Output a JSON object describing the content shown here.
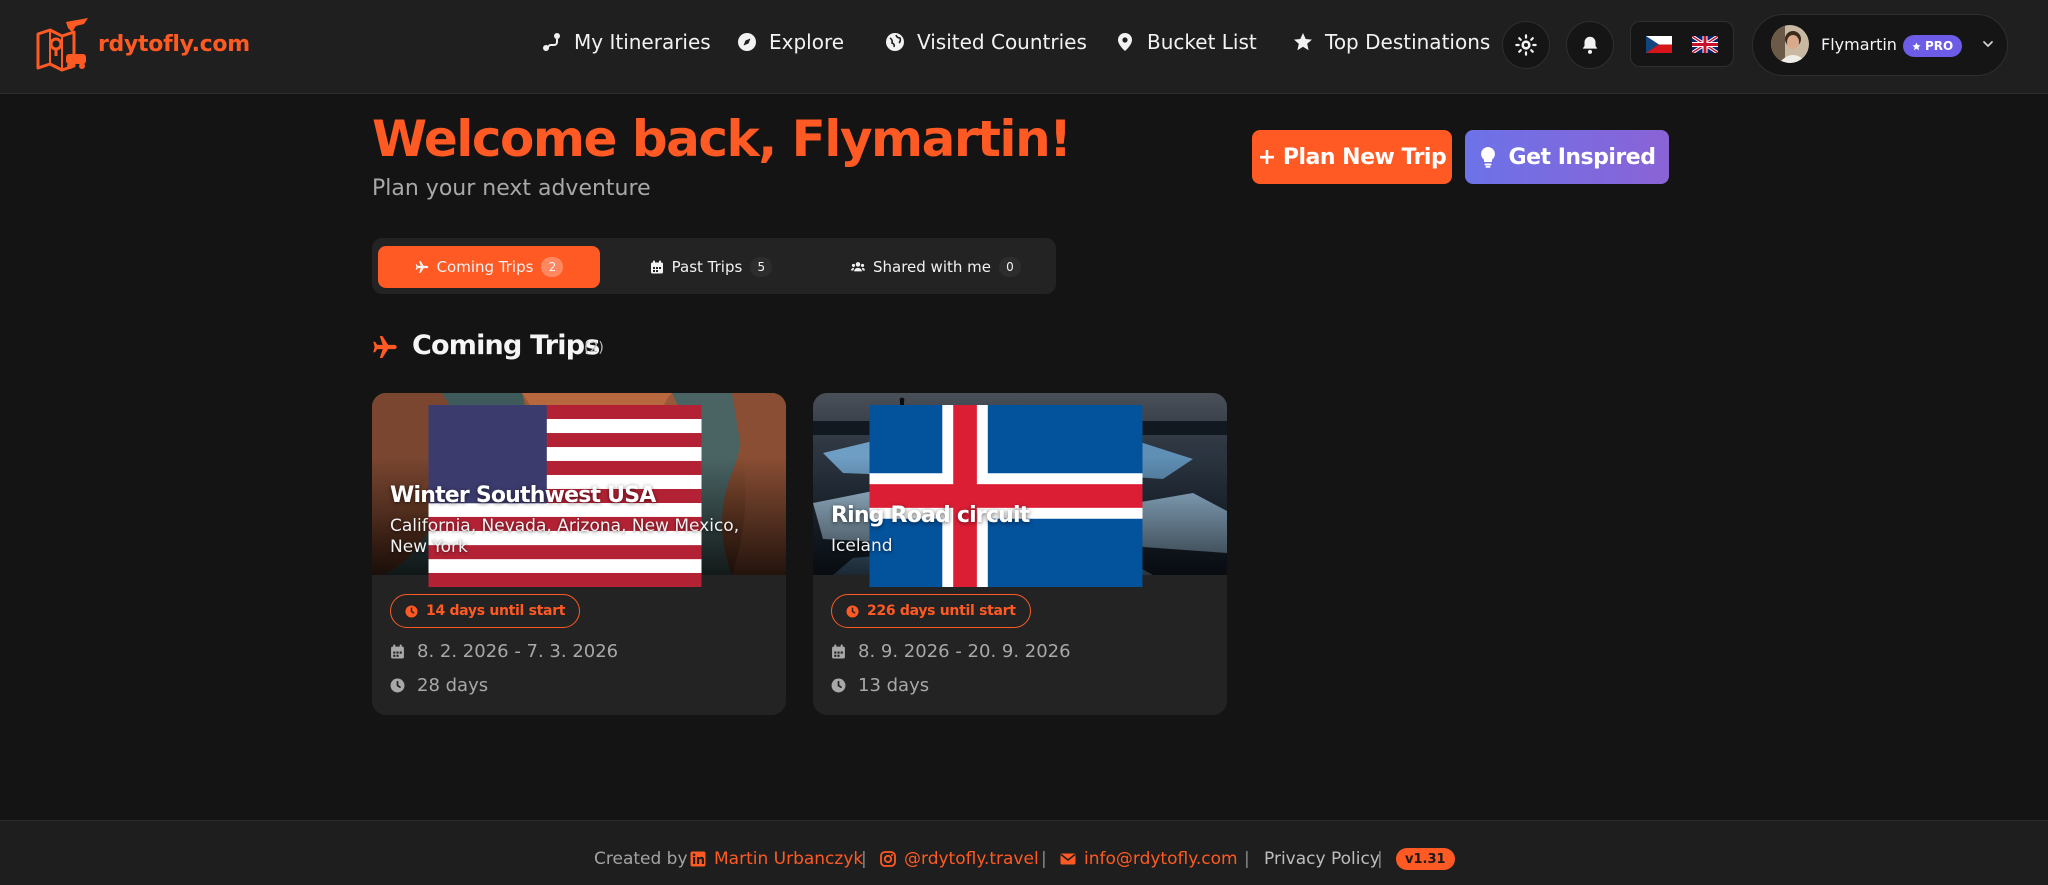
{
  "brand": {
    "name": "rdytofly.com",
    "accent": "#ff5a24",
    "purple": "#6c5ce7"
  },
  "nav": {
    "items": [
      {
        "label": "My Itineraries",
        "icon": "route-icon"
      },
      {
        "label": "Explore",
        "icon": "compass-icon"
      },
      {
        "label": "Visited Countries",
        "icon": "globe-icon"
      },
      {
        "label": "Bucket List",
        "icon": "map-pin-icon"
      },
      {
        "label": "Top Destinations",
        "icon": "star-icon"
      }
    ],
    "theme_icon": "sun-icon",
    "notifications_icon": "bell-icon",
    "languages": [
      "Czech",
      "English"
    ]
  },
  "user": {
    "name": "Flymartin",
    "badge": "PRO"
  },
  "welcome": {
    "title": "Welcome back, Flymartin!",
    "subtitle": "Plan your next adventure"
  },
  "actions": {
    "plan": "+ Plan New Trip",
    "inspired": "Get Inspired"
  },
  "tabs": [
    {
      "label": "Coming Trips",
      "count": "2",
      "icon": "plane-icon",
      "active": true
    },
    {
      "label": "Past Trips",
      "count": "5",
      "icon": "calendar-icon",
      "active": false
    },
    {
      "label": "Shared with me",
      "count": "0",
      "icon": "users-icon",
      "active": false
    }
  ],
  "section": {
    "title": "Coming Trips",
    "count": "(2)"
  },
  "trips": [
    {
      "title": "Winter Southwest USA",
      "subtitle": "California, Nevada, Arizona, New Mexico, New York",
      "flag": "United States",
      "until": "14 days until start",
      "dates": "8. 2. 2026 - 7. 3. 2026",
      "duration": "28 days"
    },
    {
      "title": "Ring Road circuit",
      "subtitle": "Iceland",
      "flag": "Iceland",
      "until": "226 days until start",
      "dates": "8. 9. 2026 - 20. 9. 2026",
      "duration": "13 days"
    }
  ],
  "footer": {
    "created_by": "Created by",
    "author": "Martin Urbanczyk",
    "instagram": "@rdytofly.travel",
    "email": "info@rdytofly.com",
    "privacy": "Privacy Policy",
    "version": "v1.31",
    "separator": "|"
  }
}
